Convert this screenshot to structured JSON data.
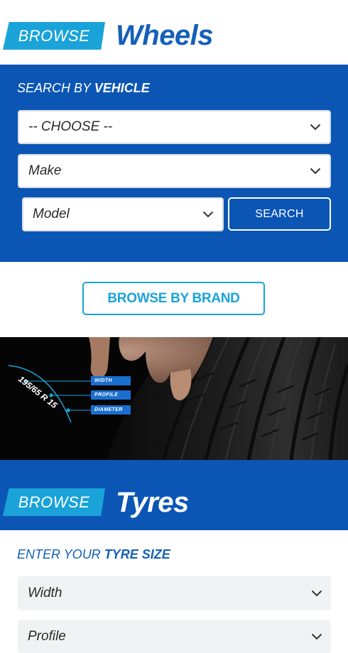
{
  "wheels_header": {
    "tag": "BROWSE",
    "title": "Wheels"
  },
  "vehicle_search": {
    "heading_prefix": "SEARCH BY ",
    "heading_emphasis": "VEHICLE",
    "choose_value": "-- CHOOSE --",
    "make_value": "Make",
    "model_value": "Model",
    "search_label": "SEARCH"
  },
  "brand": {
    "label": "BROWSE BY BRAND"
  },
  "hero": {
    "tyre_size": "195/65 R 15",
    "labels": [
      "WIDTH",
      "PROFILE",
      "DIAMETER"
    ]
  },
  "tyres_header": {
    "tag": "BROWSE",
    "title": "Tyres"
  },
  "tyre_size_search": {
    "heading_prefix": "ENTER YOUR ",
    "heading_emphasis": "TYRE SIZE",
    "width_value": "Width",
    "profile_value": "Profile"
  },
  "colors": {
    "primary_blue": "#0b56b5",
    "accent_cyan": "#1aa3d8",
    "title_blue": "#1560b8"
  }
}
